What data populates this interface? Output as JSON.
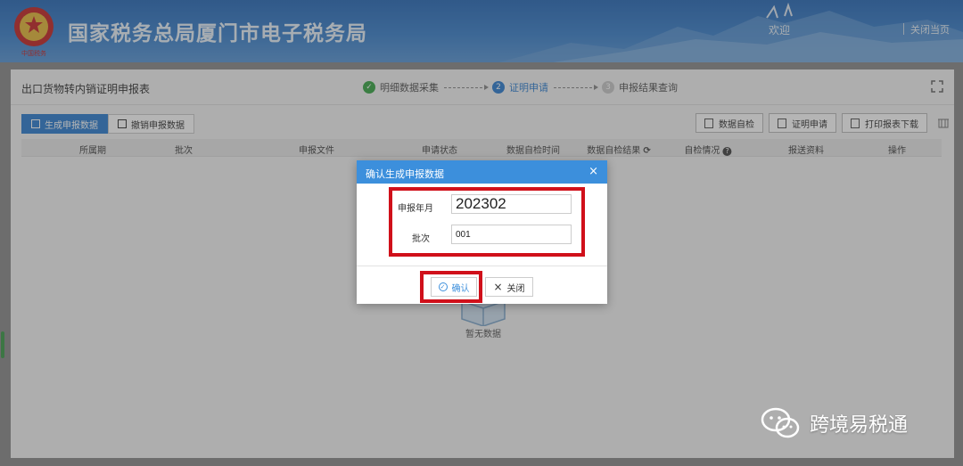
{
  "header": {
    "site_title": "国家税务总局厦门市电子税务局",
    "emblem_caption": "中国税务",
    "welcome": "欢迎",
    "close_page": "关闭当页"
  },
  "page": {
    "title": "出口货物转内销证明申报表",
    "steps": [
      {
        "label": "明细数据采集",
        "state": "done"
      },
      {
        "label": "证明申请",
        "state": "current",
        "number": "2"
      },
      {
        "label": "申报结果查询",
        "state": "todo",
        "number": "3"
      }
    ]
  },
  "tabs": [
    {
      "label": "生成申报数据",
      "active": true
    },
    {
      "label": "撤销申报数据",
      "active": false
    }
  ],
  "toolbar": {
    "data_check": "数据自检",
    "cert_apply": "证明申请",
    "print_download": "打印报表下载"
  },
  "table": {
    "columns": [
      "所属期",
      "批次",
      "申报文件",
      "申请状态",
      "数据自检时间",
      "数据自检结果",
      "自检情况",
      "报送资料",
      "操作"
    ]
  },
  "empty": {
    "text": "暂无数据"
  },
  "modal": {
    "title": "确认生成申报数据",
    "period_label": "申报年月",
    "period_value": "202302",
    "batch_label": "批次",
    "batch_value": "001",
    "confirm_label": "确认",
    "close_label": "关闭"
  },
  "watermark": {
    "text": "跨境易税通"
  },
  "colors": {
    "header_blue": "#3d82cc",
    "accent_blue": "#2f7fd0",
    "modal_header": "#3c8fdc",
    "success_green": "#3aa648",
    "highlight_red": "#d0101a"
  }
}
